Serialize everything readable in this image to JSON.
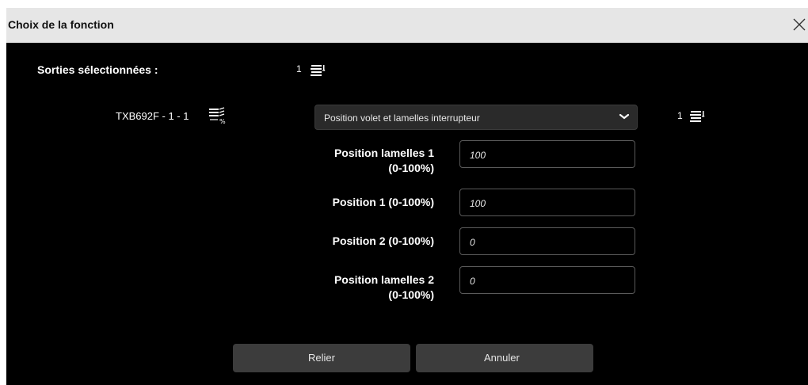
{
  "dialog": {
    "title": "Choix de la fonction",
    "close_icon": "close-icon"
  },
  "selected_outputs": {
    "label": "Sorties sélectionnées :",
    "count": "1",
    "icon": "roller-shutter-icon"
  },
  "output_row": {
    "name": "TXB692F - 1 - 1",
    "icon": "blinds-percent-icon",
    "function_select": {
      "value": "Position volet et lamelles interrupteur",
      "icon": "chevron-down-icon"
    },
    "count": "1",
    "count_icon": "roller-shutter-icon"
  },
  "fields": [
    {
      "label_line1": "Position lamelles 1",
      "label_line2": "(0-100%)",
      "value": "100"
    },
    {
      "label_line1": "Position 1 (0-100%)",
      "label_line2": "",
      "value": "100"
    },
    {
      "label_line1": "Position 2 (0-100%)",
      "label_line2": "",
      "value": "0"
    },
    {
      "label_line1": "Position lamelles 2",
      "label_line2": "(0-100%)",
      "value": "0"
    }
  ],
  "buttons": {
    "link_label": "Relier",
    "cancel_label": "Annuler"
  }
}
